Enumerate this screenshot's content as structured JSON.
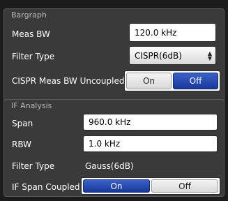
{
  "bargraph": {
    "title": "Bargraph",
    "meas_bw": {
      "label": "Meas BW",
      "value": "120.0 kHz"
    },
    "filter_type": {
      "label": "Filter Type",
      "value": "CISPR(6dB)",
      "arrow_icon": "updown-arrow-icon"
    },
    "cispr_uncoupled": {
      "label": "CISPR Meas BW Uncoupled",
      "on": "On",
      "off": "Off",
      "selected": "Off"
    }
  },
  "if_analysis": {
    "title": "IF Analysis",
    "span": {
      "label": "Span",
      "value": "960.0 kHz"
    },
    "rbw": {
      "label": "RBW",
      "value": "1.0 kHz"
    },
    "filter_type": {
      "label": "Filter Type",
      "value": "Gauss(6dB)"
    },
    "if_span_coupled": {
      "label": "IF Span Coupled",
      "on": "On",
      "off": "Off",
      "selected": "On"
    }
  },
  "colors": {
    "accent": "#2a4ab5",
    "panel": "#3a3a3a",
    "background": "#1c1c1c"
  }
}
